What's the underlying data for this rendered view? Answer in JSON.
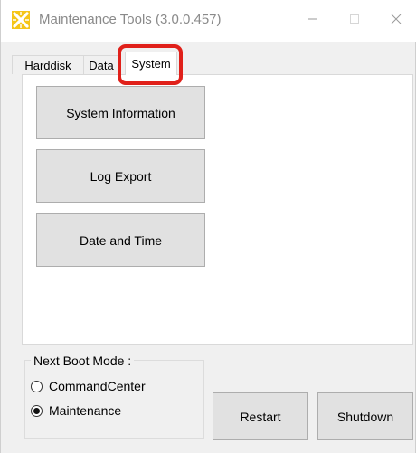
{
  "window": {
    "title": "Maintenance Tools (3.0.0.457)",
    "icon": "yellow-x-app-icon",
    "controls": {
      "minimize_icon": "minimize-icon",
      "maximize_icon": "maximize-icon",
      "close_icon": "close-icon"
    }
  },
  "tabs": [
    {
      "label": "Harddisk",
      "selected": false
    },
    {
      "label": "Data",
      "selected": false
    },
    {
      "label": "System",
      "selected": true
    }
  ],
  "highlight_color": "#e0201a",
  "system_panel": {
    "buttons": [
      {
        "label": "System Information"
      },
      {
        "label": "Log Export"
      },
      {
        "label": "Date and Time"
      }
    ]
  },
  "boot_mode": {
    "label": "Next Boot Mode :",
    "options": [
      {
        "label": "CommandCenter",
        "checked": false
      },
      {
        "label": "Maintenance",
        "checked": true
      }
    ]
  },
  "actions": {
    "restart_label": "Restart",
    "shutdown_label": "Shutdown"
  },
  "colors": {
    "app_icon_yellow": "#f5c518",
    "window_bg": "#f0f0f0",
    "button_bg": "#e1e1e1"
  }
}
